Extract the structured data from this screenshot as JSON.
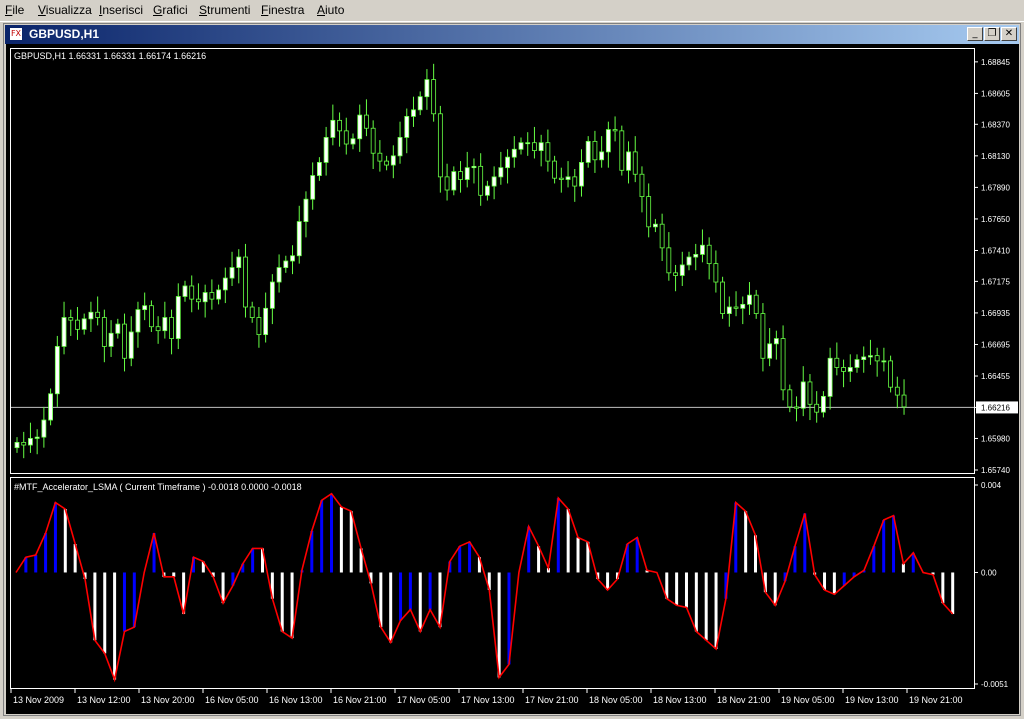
{
  "menu": [
    {
      "label": "File",
      "underline": "F",
      "rest": "ile"
    },
    {
      "label": "Visualizza",
      "underline": "V",
      "rest": "isualizza"
    },
    {
      "label": "Inserisci",
      "underline": "I",
      "rest": "nserisci"
    },
    {
      "label": "Grafici",
      "underline": "G",
      "rest": "rafici"
    },
    {
      "label": "Strumenti",
      "underline": "S",
      "rest": "trumenti"
    },
    {
      "label": "Finestra",
      "underline": "F",
      "rest": "inestra"
    },
    {
      "label": "Aiuto",
      "underline": "A",
      "rest": "iuto"
    }
  ],
  "window": {
    "title": "GBPUSD,H1",
    "minimize_glyph": "_",
    "restore_glyph": "❐",
    "close_glyph": "✕",
    "icon_glyph": "FX"
  },
  "main_chart": {
    "info": "GBPUSD,H1  1.66331 1.66331 1.66174 1.66216",
    "current_price_label": "1.66216",
    "y_ticks": [
      "1.68845",
      "1.68605",
      "1.68370",
      "1.68130",
      "1.67890",
      "1.67650",
      "1.67410",
      "1.67175",
      "1.66935",
      "1.66695",
      "1.66455",
      "1.66216",
      "1.65980",
      "1.65740"
    ]
  },
  "indicator": {
    "info": "#MTF_Accelerator_LSMA ( Current Timeframe ) -0.0018 0.0000 -0.0018",
    "y_ticks": [
      "0.004",
      "0.00",
      "-0.0051"
    ]
  },
  "x_axis": [
    "13 Nov 2009",
    "13 Nov 12:00",
    "13 Nov 20:00",
    "16 Nov 05:00",
    "16 Nov 13:00",
    "16 Nov 21:00",
    "17 Nov 05:00",
    "17 Nov 13:00",
    "17 Nov 21:00",
    "18 Nov 05:00",
    "18 Nov 13:00",
    "18 Nov 21:00",
    "19 Nov 05:00",
    "19 Nov 13:00",
    "19 Nov 21:00"
  ],
  "colors": {
    "background": "#000000",
    "bull_candle": "#ffffff",
    "bear_candle": "#000000",
    "candle_outline": "#66ff44",
    "grid_text": "#ffffff",
    "price_line": "#c0c0c0",
    "bar_blue": "#0000ff",
    "bar_white": "#ffffff",
    "lsma_line": "#ff0000"
  },
  "chart_data": {
    "type": "candlestick",
    "symbol": "GBPUSD",
    "timeframe": "H1",
    "ylim": [
      1.6574,
      1.6892
    ],
    "close": [
      1.6595,
      1.6593,
      1.6598,
      1.6599,
      1.6612,
      1.6632,
      1.6668,
      1.669,
      1.6688,
      1.6681,
      1.6689,
      1.6694,
      1.669,
      1.6668,
      1.6678,
      1.6685,
      1.6659,
      1.6679,
      1.6696,
      1.6699,
      1.6683,
      1.668,
      1.669,
      1.6674,
      1.6706,
      1.6714,
      1.6704,
      1.6702,
      1.6709,
      1.6704,
      1.6711,
      1.672,
      1.6728,
      1.6736,
      1.6698,
      1.669,
      1.6677,
      1.6697,
      1.6717,
      1.6728,
      1.6733,
      1.6737,
      1.6763,
      1.678,
      1.6798,
      1.6808,
      1.6827,
      1.684,
      1.6832,
      1.6822,
      1.6826,
      1.6844,
      1.6834,
      1.6815,
      1.6809,
      1.6806,
      1.6813,
      1.6827,
      1.6843,
      1.6848,
      1.6858,
      1.6871,
      1.6845,
      1.6797,
      1.6787,
      1.6801,
      1.6795,
      1.6804,
      1.6805,
      1.6783,
      1.679,
      1.6797,
      1.6804,
      1.6812,
      1.6818,
      1.6823,
      1.6823,
      1.6817,
      1.6823,
      1.6809,
      1.6796,
      1.6795,
      1.6797,
      1.679,
      1.6808,
      1.6824,
      1.681,
      1.6816,
      1.6833,
      1.6832,
      1.6802,
      1.6816,
      1.6799,
      1.6782,
      1.6759,
      1.6761,
      1.6743,
      1.6724,
      1.6722,
      1.673,
      1.6736,
      1.6738,
      1.6745,
      1.6731,
      1.6717,
      1.6693,
      1.6698,
      1.6697,
      1.67,
      1.6707,
      1.6693,
      1.6659,
      1.667,
      1.6674,
      1.6635,
      1.6622,
      1.6621,
      1.6641,
      1.6624,
      1.6618,
      1.663,
      1.6659,
      1.6652,
      1.6649,
      1.6652,
      1.6658,
      1.666,
      1.6661,
      1.6657,
      1.6657,
      1.6637,
      1.6631,
      1.6622
    ]
  },
  "indicator_data": {
    "type": "bar+line",
    "ylim": [
      -0.0051,
      0.004
    ],
    "values": [
      0.0,
      0.0007,
      0.0008,
      0.0018,
      0.0032,
      0.0029,
      0.0013,
      -0.0003,
      -0.0031,
      -0.0037,
      -0.0049,
      -0.0027,
      -0.0025,
      0.0,
      0.0018,
      -0.0002,
      -0.0002,
      -0.0019,
      0.0007,
      0.0005,
      -0.0002,
      -0.0014,
      -0.0006,
      0.0004,
      0.0011,
      0.0011,
      -0.0012,
      -0.0027,
      -0.003,
      0.0001,
      0.0019,
      0.0033,
      0.0036,
      0.003,
      0.0028,
      0.0011,
      -0.0005,
      -0.0025,
      -0.0032,
      -0.0022,
      -0.0017,
      -0.0027,
      -0.0017,
      -0.0025,
      0.0005,
      0.0012,
      0.0014,
      0.0007,
      -0.0008,
      -0.0048,
      -0.0042,
      0.0,
      0.0021,
      0.0012,
      0.0002,
      0.0034,
      0.0029,
      0.0016,
      0.0014,
      -0.0003,
      -0.0008,
      -0.0003,
      0.0013,
      0.0016,
      0.0001,
      0.0,
      -0.0012,
      -0.0015,
      -0.0016,
      -0.0027,
      -0.0031,
      -0.0035,
      -0.0012,
      0.0032,
      0.0028,
      0.0017,
      -0.0009,
      -0.0015,
      -0.0004,
      0.0012,
      0.0027,
      -0.0001,
      -0.0008,
      -0.001,
      -0.0006,
      -0.0002,
      0.0001,
      0.0012,
      0.0024,
      0.0026,
      0.0004,
      0.0009,
      0.0,
      -0.0001,
      -0.0014,
      -0.0019
    ],
    "colors": [
      "w",
      "b",
      "b",
      "b",
      "b",
      "w",
      "w",
      "w",
      "w",
      "w",
      "w",
      "b",
      "b",
      "b",
      "b",
      "w",
      "w",
      "w",
      "b",
      "w",
      "w",
      "w",
      "b",
      "b",
      "b",
      "w",
      "w",
      "w",
      "w",
      "b",
      "b",
      "b",
      "b",
      "w",
      "w",
      "w",
      "w",
      "w",
      "w",
      "b",
      "b",
      "w",
      "b",
      "w",
      "b",
      "b",
      "b",
      "w",
      "w",
      "w",
      "b",
      "b",
      "b",
      "w",
      "w",
      "b",
      "w",
      "w",
      "w",
      "w",
      "w",
      "w",
      "b",
      "b",
      "w",
      "w",
      "w",
      "w",
      "w",
      "w",
      "w",
      "w",
      "b",
      "b",
      "w",
      "w",
      "w",
      "w",
      "b",
      "b",
      "b",
      "w",
      "w",
      "w",
      "b",
      "b",
      "b",
      "b",
      "b",
      "b",
      "w",
      "b",
      "w",
      "w",
      "w",
      "w"
    ]
  }
}
